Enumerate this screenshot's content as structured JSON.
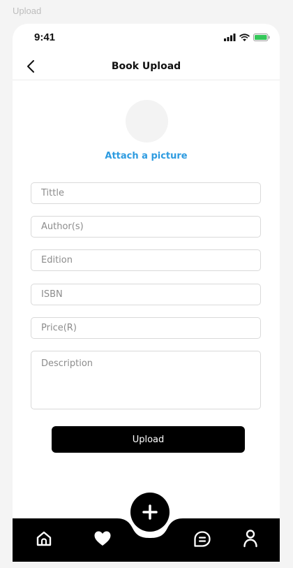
{
  "frame": {
    "label": "Upload"
  },
  "status_bar": {
    "time": "9:41",
    "battery_color": "#34c759"
  },
  "header": {
    "title": "Book Upload",
    "back_icon": "chevron-left-icon"
  },
  "picture": {
    "attach_label": "Attach a picture",
    "link_color": "#2d9be0"
  },
  "form": {
    "title_placeholder": "Tittle",
    "author_placeholder": "Author(s)",
    "edition_placeholder": "Edition",
    "isbn_placeholder": "ISBN",
    "price_placeholder": "Price(R)",
    "description_placeholder": "Description",
    "submit_label": "Upload"
  },
  "bottom_nav": {
    "items": [
      {
        "icon": "home-icon"
      },
      {
        "icon": "heart-icon"
      },
      {
        "icon": "plus-icon"
      },
      {
        "icon": "chat-icon"
      },
      {
        "icon": "user-icon"
      }
    ]
  }
}
